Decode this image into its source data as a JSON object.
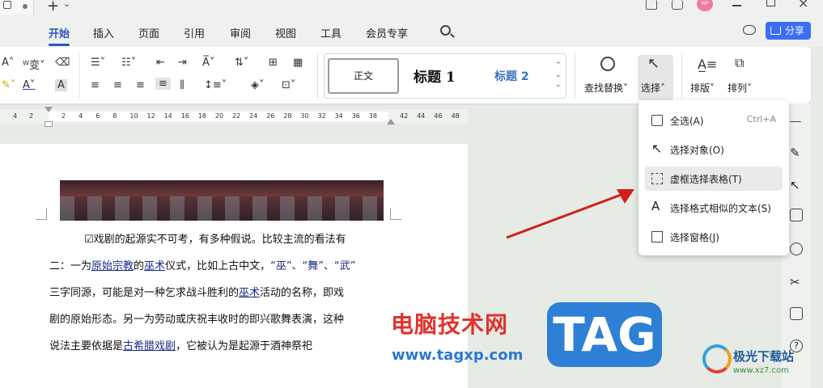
{
  "menu": {
    "tabs": [
      "开始",
      "插入",
      "页面",
      "引用",
      "审阅",
      "视图",
      "工具",
      "会员专享"
    ],
    "share_label": "分享"
  },
  "avatar_text": "WP",
  "ribbon": {
    "font_size_sym": "wén",
    "style_normal": "正文",
    "style_h1": "标题 1",
    "style_h2": "标题 2",
    "find_replace": "查找替换",
    "select": "选择",
    "layout": "排版",
    "arrange": "排列"
  },
  "ruler": {
    "left_nums": [
      "4",
      "2"
    ],
    "nums": [
      "2",
      "4",
      "6",
      "8",
      "10",
      "12",
      "14",
      "16",
      "18",
      "20",
      "22",
      "24",
      "26",
      "28",
      "30",
      "32",
      "34",
      "36",
      "38"
    ],
    "right_nums": [
      "42",
      "44",
      "46",
      "48"
    ]
  },
  "document": {
    "line1": "☑戏剧的起源实不可考，有多种假说。比较主流的看法有",
    "line2_a": "二：一为",
    "line2_b": "原始宗教",
    "line2_c": "的",
    "line2_d": "巫术",
    "line2_e": "仪式，比如上古中文，",
    "line2_f": "“巫”、“舞”、“武”",
    "line3_a": "三字同源，可能是对一种乞求战斗胜利的",
    "line3_b": "巫术",
    "line3_c": "活动的名称，即戏",
    "line4": "剧的原始形态。另一为劳动或庆祝丰收时的即兴歌舞表演，这种",
    "line5_a": "说法主要依据是",
    "line5_b": "古希腊戏剧",
    "line5_c": "，它被认为是起源于酒神祭祀"
  },
  "dropdown": {
    "items": [
      {
        "label": "全选(A)",
        "shortcut": "Ctrl+A"
      },
      {
        "label": "选择对象(O)"
      },
      {
        "label": "虚框选择表格(T)"
      },
      {
        "label": "选择格式相似的文本(S)"
      },
      {
        "label": "选择窗格(J)"
      }
    ]
  },
  "watermarks": {
    "site_cn": "电脑技术网",
    "site_url": "www.tagxp.com",
    "tag": "TAG",
    "logo_cn": "极光下载站",
    "logo_url": "www.xz7.com"
  }
}
